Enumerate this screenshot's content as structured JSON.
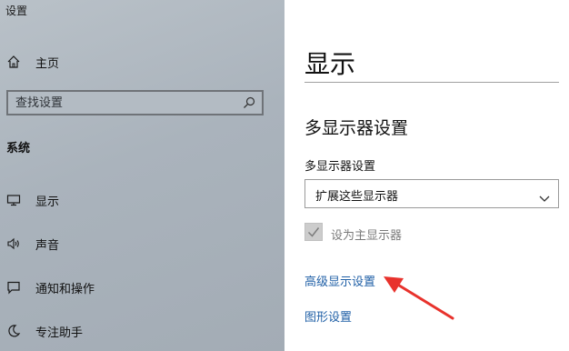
{
  "window": {
    "title": "设置"
  },
  "sidebar": {
    "home": {
      "label": "主页",
      "icon": "home-icon"
    },
    "search": {
      "placeholder": "查找设置",
      "icon": "search-icon"
    },
    "section": "系统",
    "items": [
      {
        "label": "显示",
        "icon": "monitor-icon"
      },
      {
        "label": "声音",
        "icon": "speaker-icon"
      },
      {
        "label": "通知和操作",
        "icon": "notification-icon"
      },
      {
        "label": "专注助手",
        "icon": "moon-icon"
      }
    ]
  },
  "main": {
    "title": "显示",
    "section_title": "多显示器设置",
    "dropdown_label": "多显示器设置",
    "dropdown_value": "扩展这些显示器",
    "checkbox_label": "设为主显示器",
    "checkbox_checked": true,
    "links": {
      "advanced": "高级显示设置",
      "graphics": "图形设置"
    }
  },
  "annotation": {
    "type": "red-arrow",
    "points_to": "高级显示设置",
    "color": "#e8322c"
  },
  "colors": {
    "link": "#1f5fa6",
    "accent_arrow": "#e8322c"
  }
}
